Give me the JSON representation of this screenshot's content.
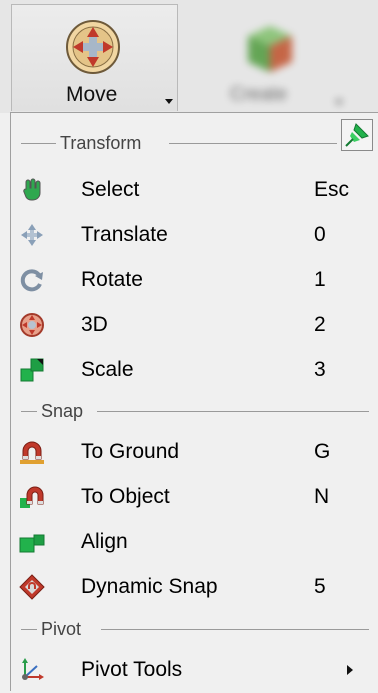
{
  "ribbon": {
    "move_label": "Move",
    "create_label": "Create",
    "move_icon": "move-gizmo-icon",
    "create_icon": "create-box-icon"
  },
  "menu": {
    "sections": {
      "transform": "Transform",
      "snap": "Snap",
      "pivot": "Pivot"
    },
    "transform_items": [
      {
        "label": "Select",
        "shortcut": "Esc",
        "icon": "select-hand-icon"
      },
      {
        "label": "Translate",
        "shortcut": "0",
        "icon": "translate-arrows-icon"
      },
      {
        "label": "Rotate",
        "shortcut": "1",
        "icon": "rotate-icon"
      },
      {
        "label": "3D",
        "shortcut": "2",
        "icon": "gizmo-3d-icon"
      },
      {
        "label": "Scale",
        "shortcut": "3",
        "icon": "scale-icon"
      }
    ],
    "snap_items": [
      {
        "label": "To Ground",
        "shortcut": "G",
        "icon": "magnet-ground-icon"
      },
      {
        "label": "To Object",
        "shortcut": "N",
        "icon": "magnet-object-icon"
      },
      {
        "label": "Align",
        "shortcut": "",
        "icon": "align-icon"
      },
      {
        "label": "Dynamic Snap",
        "shortcut": "5",
        "icon": "dynamic-snap-icon"
      }
    ],
    "pivot_items": [
      {
        "label": "Pivot Tools",
        "shortcut": "",
        "icon": "pivot-tools-icon"
      }
    ],
    "accent_colors": {
      "green": "#22b24c",
      "red": "#c0392b"
    }
  }
}
